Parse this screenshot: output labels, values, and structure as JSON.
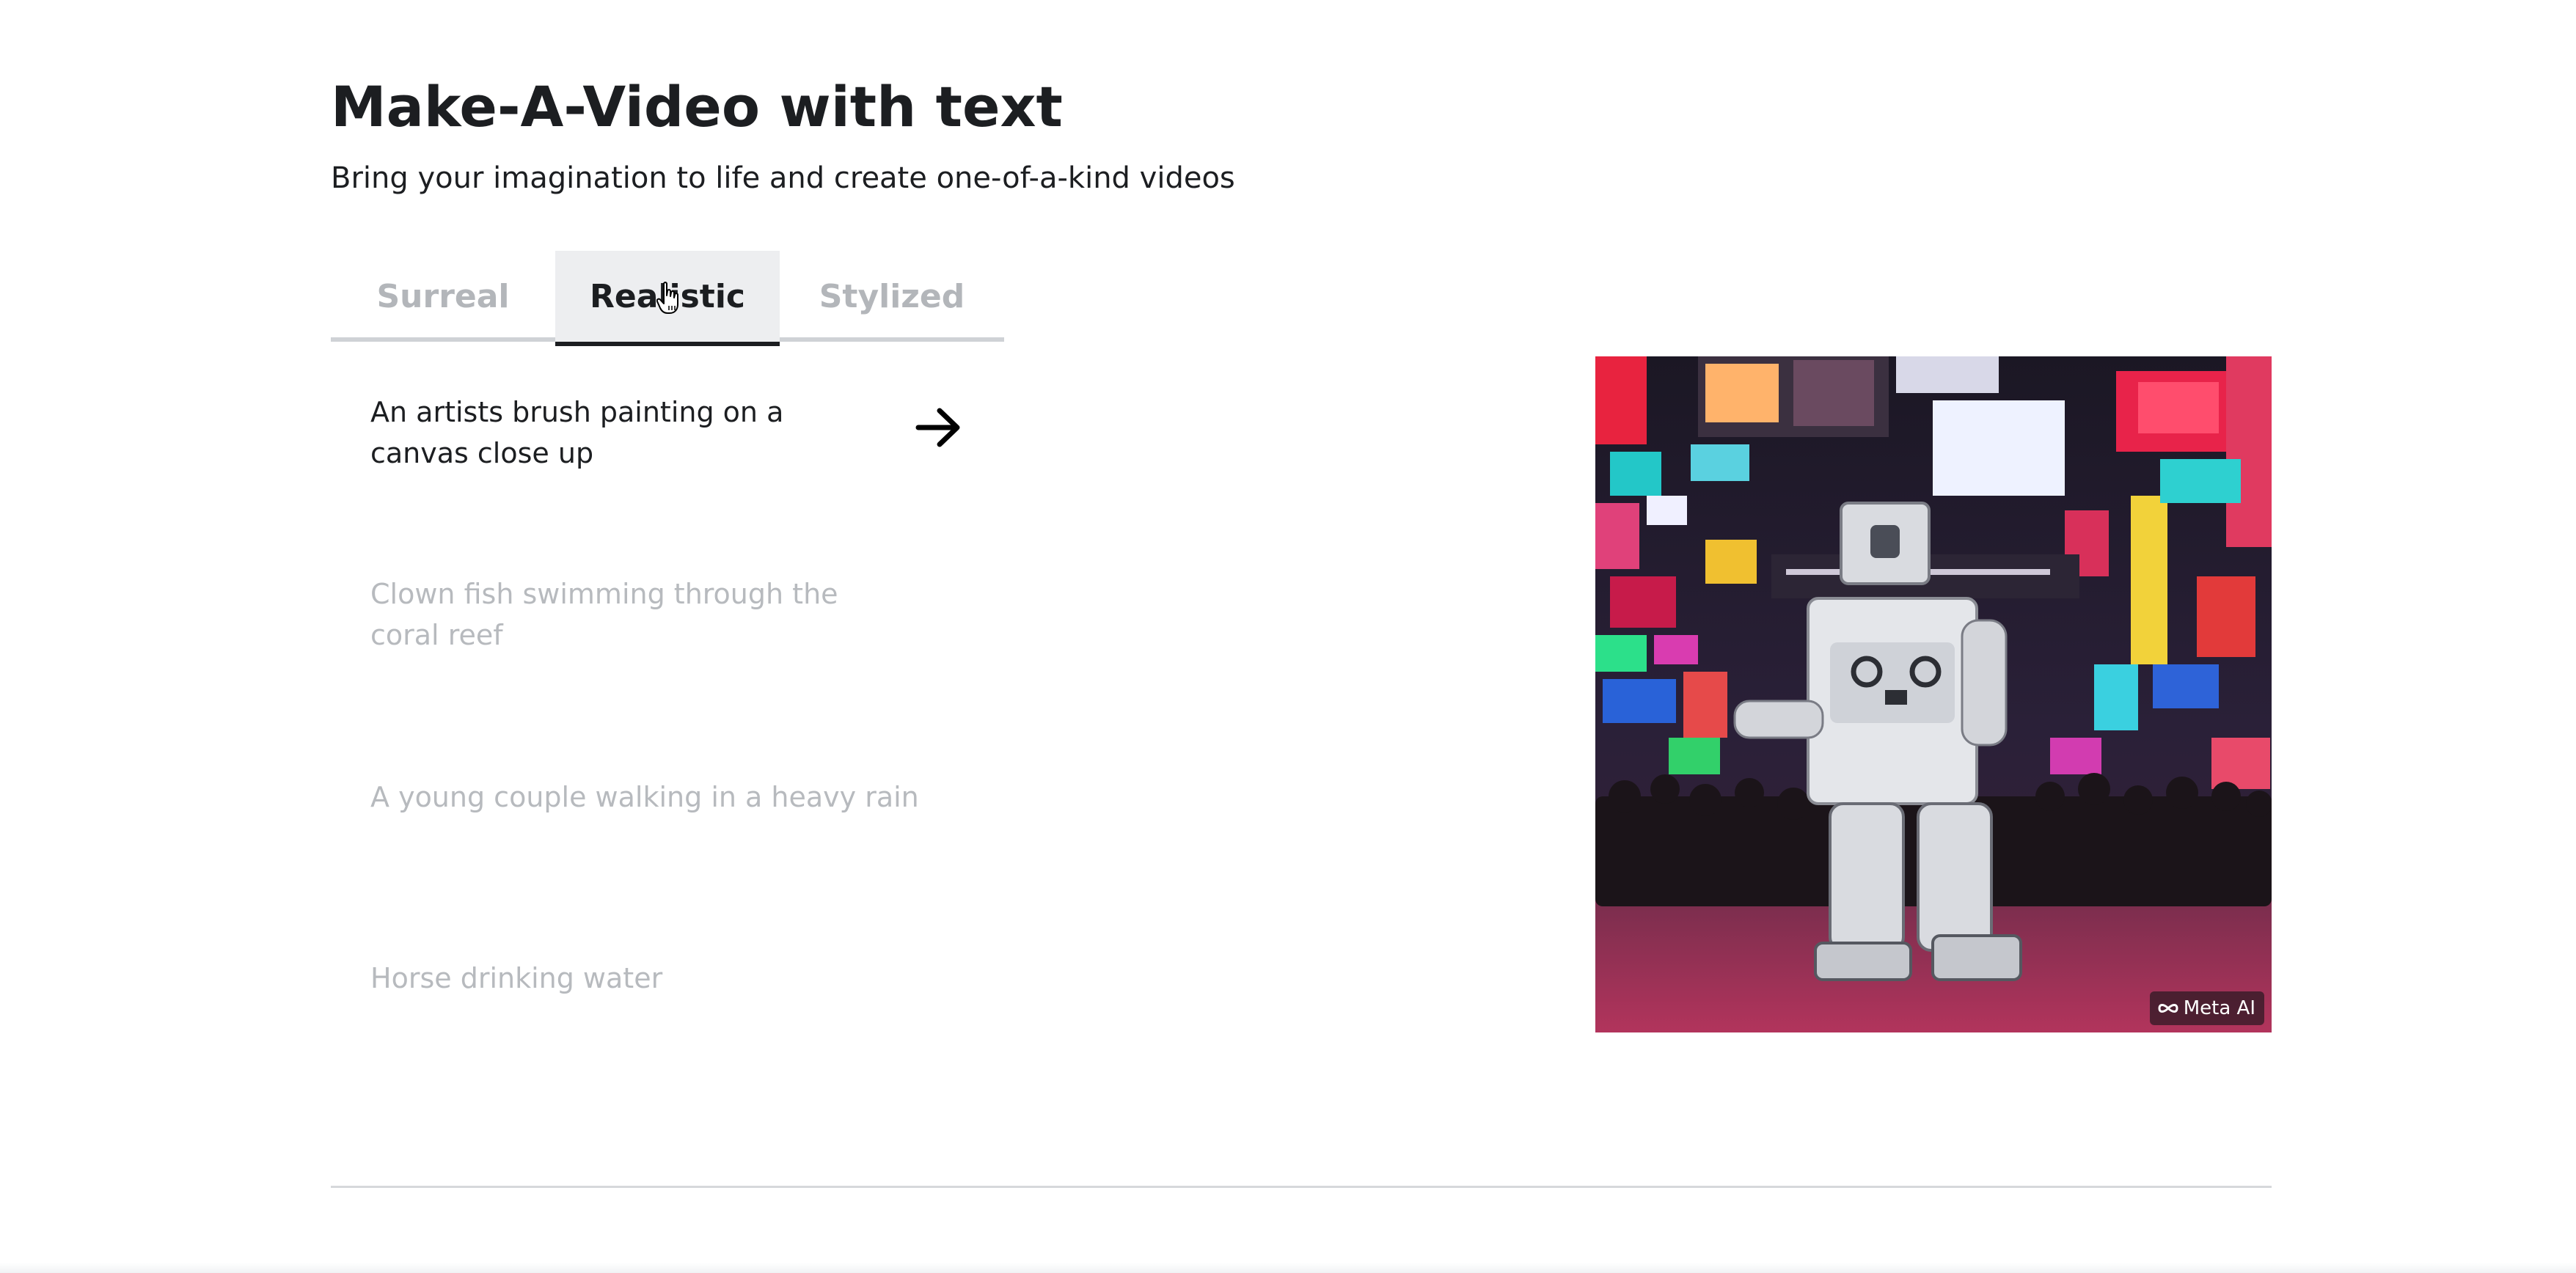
{
  "header": {
    "title": "Make-A-Video with text",
    "subtitle": "Bring your imagination to life and create one-of-a-kind videos"
  },
  "tabs": [
    {
      "label": "Surreal",
      "active": false
    },
    {
      "label": "Realistic",
      "active": true
    },
    {
      "label": "Stylized",
      "active": false
    }
  ],
  "prompts": [
    {
      "text": "An artists brush painting on a canvas close up",
      "active": true
    },
    {
      "text": "Clown fish swimming through the coral reef",
      "active": false
    },
    {
      "text": "A young couple walking in a heavy rain",
      "active": false
    },
    {
      "text": "Horse drinking water",
      "active": false
    }
  ],
  "video": {
    "watermark": "Meta AI"
  },
  "icons": {
    "arrow": "arrow-right-icon",
    "cursor": "hand-pointer-icon",
    "meta_logo": "infinity-icon"
  },
  "colors": {
    "text_primary": "#1c1e21",
    "text_muted": "#b7babe",
    "tab_active_bg": "#edeef0",
    "tab_underline": "#cfd2d6"
  }
}
